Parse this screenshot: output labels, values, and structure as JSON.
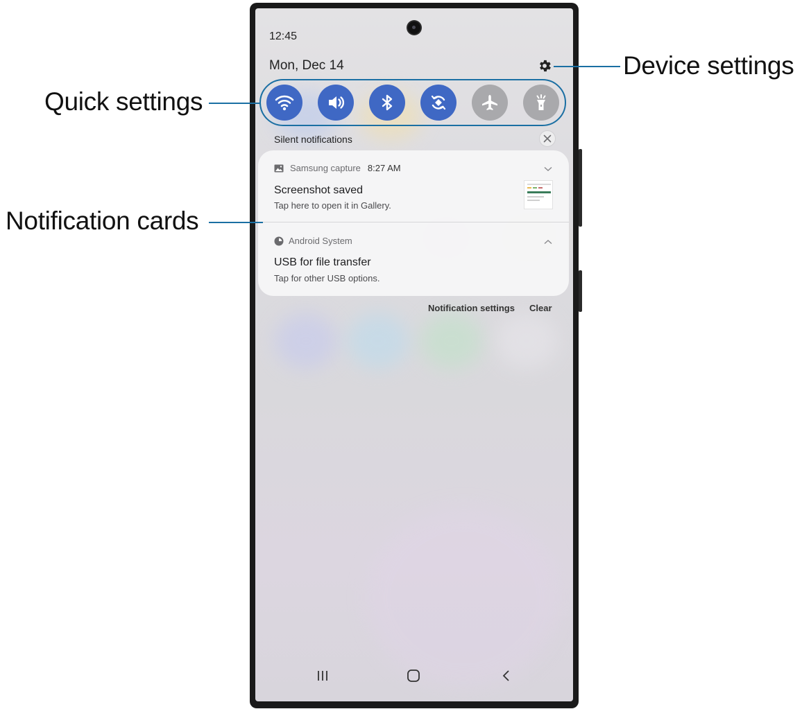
{
  "status_bar": {
    "time": "12:45"
  },
  "header": {
    "date": "Mon, Dec 14"
  },
  "quick_settings": [
    {
      "name": "wifi-icon",
      "state": "on"
    },
    {
      "name": "sound-icon",
      "state": "on"
    },
    {
      "name": "bluetooth-icon",
      "state": "on"
    },
    {
      "name": "auto-rotate-icon",
      "state": "on"
    },
    {
      "name": "airplane-mode-icon",
      "state": "off"
    },
    {
      "name": "flashlight-icon",
      "state": "off"
    }
  ],
  "notifications": {
    "section_title": "Silent notifications",
    "cards": [
      {
        "app": "Samsung capture",
        "time": "8:27 AM",
        "title": "Screenshot saved",
        "subtitle": "Tap here to open it in Gallery.",
        "icon": "gallery-icon",
        "expand": "chevron-down-icon"
      },
      {
        "app": "Android System",
        "title": "USB for file transfer",
        "subtitle": "Tap for other USB options.",
        "icon": "android-system-icon",
        "expand": "chevron-up-icon"
      }
    ],
    "actions": {
      "settings_label": "Notification settings",
      "clear_label": "Clear"
    }
  },
  "callouts": {
    "device_settings": "Device settings",
    "quick_settings": "Quick settings",
    "notification_cards": "Notification cards"
  },
  "colors": {
    "accent": "#3f68c4",
    "callout_line": "#1a6fa3",
    "toggle_off": "#a9a9ac"
  },
  "nav_bar": [
    "recent-apps-icon",
    "home-icon",
    "back-icon"
  ]
}
